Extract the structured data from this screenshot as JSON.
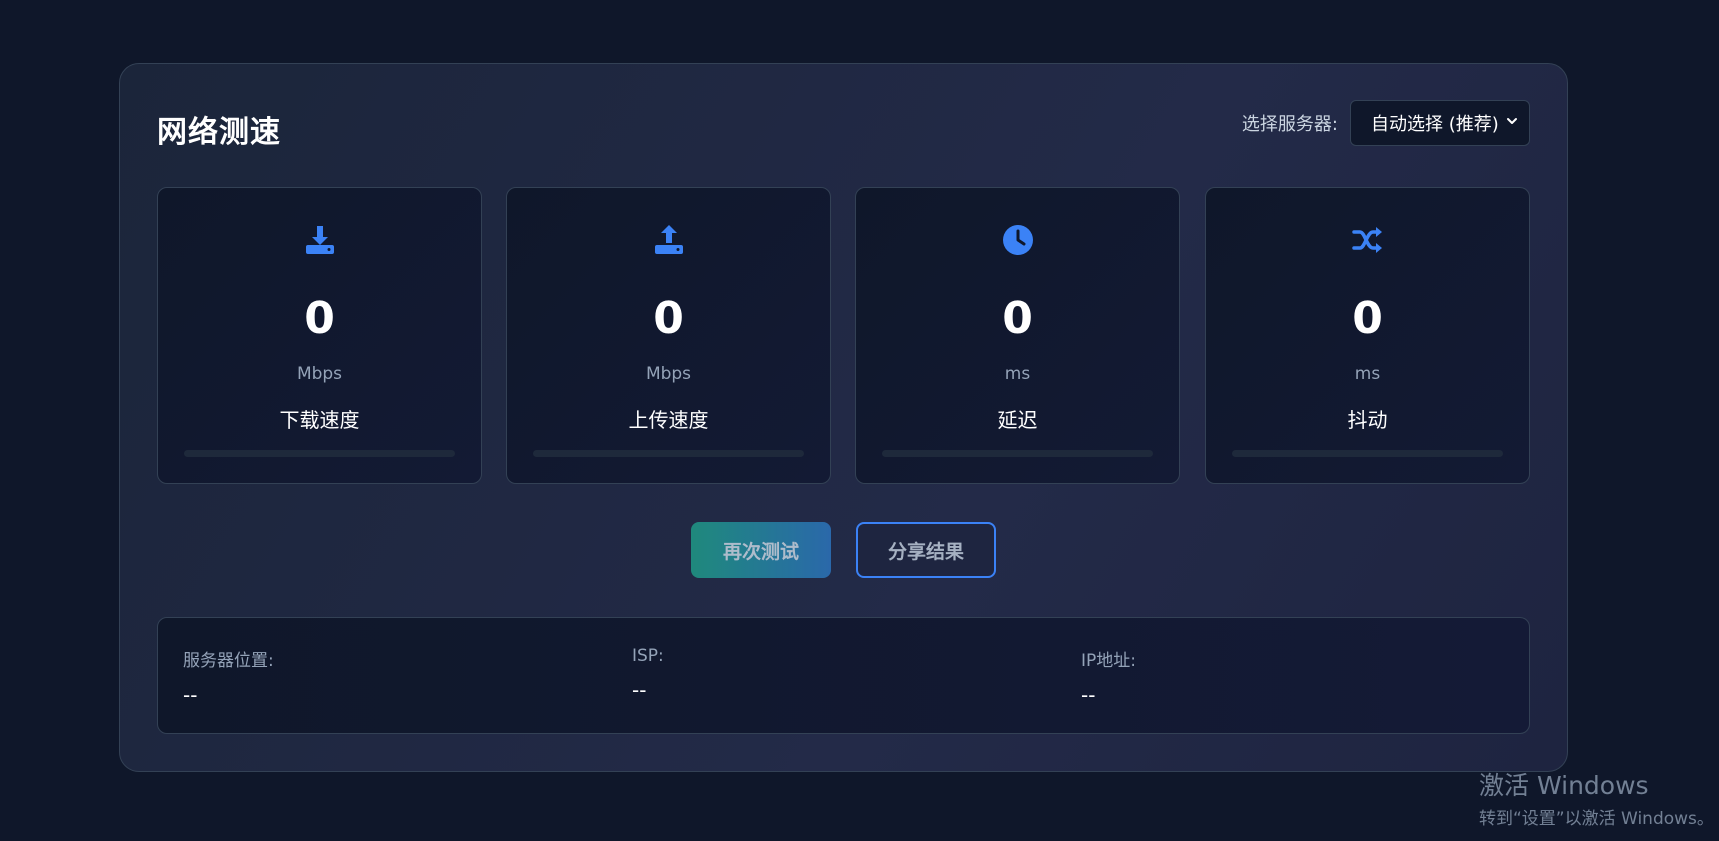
{
  "header": {
    "title": "网络测速",
    "server_label": "选择服务器:",
    "server_value": "自动选择 (推荐)"
  },
  "cards": [
    {
      "icon": "download-icon",
      "value": "0",
      "unit": "Mbps",
      "name": "下载速度",
      "progress": 0
    },
    {
      "icon": "upload-icon",
      "value": "0",
      "unit": "Mbps",
      "name": "上传速度",
      "progress": 0
    },
    {
      "icon": "clock-icon",
      "value": "0",
      "unit": "ms",
      "name": "延迟",
      "progress": 0
    },
    {
      "icon": "shuffle-icon",
      "value": "0",
      "unit": "ms",
      "name": "抖动",
      "progress": 0
    }
  ],
  "actions": {
    "retest_label": "再次测试",
    "share_label": "分享结果"
  },
  "info": {
    "server_location_label": "服务器位置:",
    "server_location_value": "--",
    "isp_label": "ISP:",
    "isp_value": "--",
    "ip_label": "IP地址:",
    "ip_value": "--"
  },
  "watermark": {
    "line1": "激活 Windows",
    "line2": "转到“设置”以激活 Windows。"
  },
  "colors": {
    "accent": "#3b82f6",
    "background": "#0f172a",
    "panel_border": "#334155"
  }
}
